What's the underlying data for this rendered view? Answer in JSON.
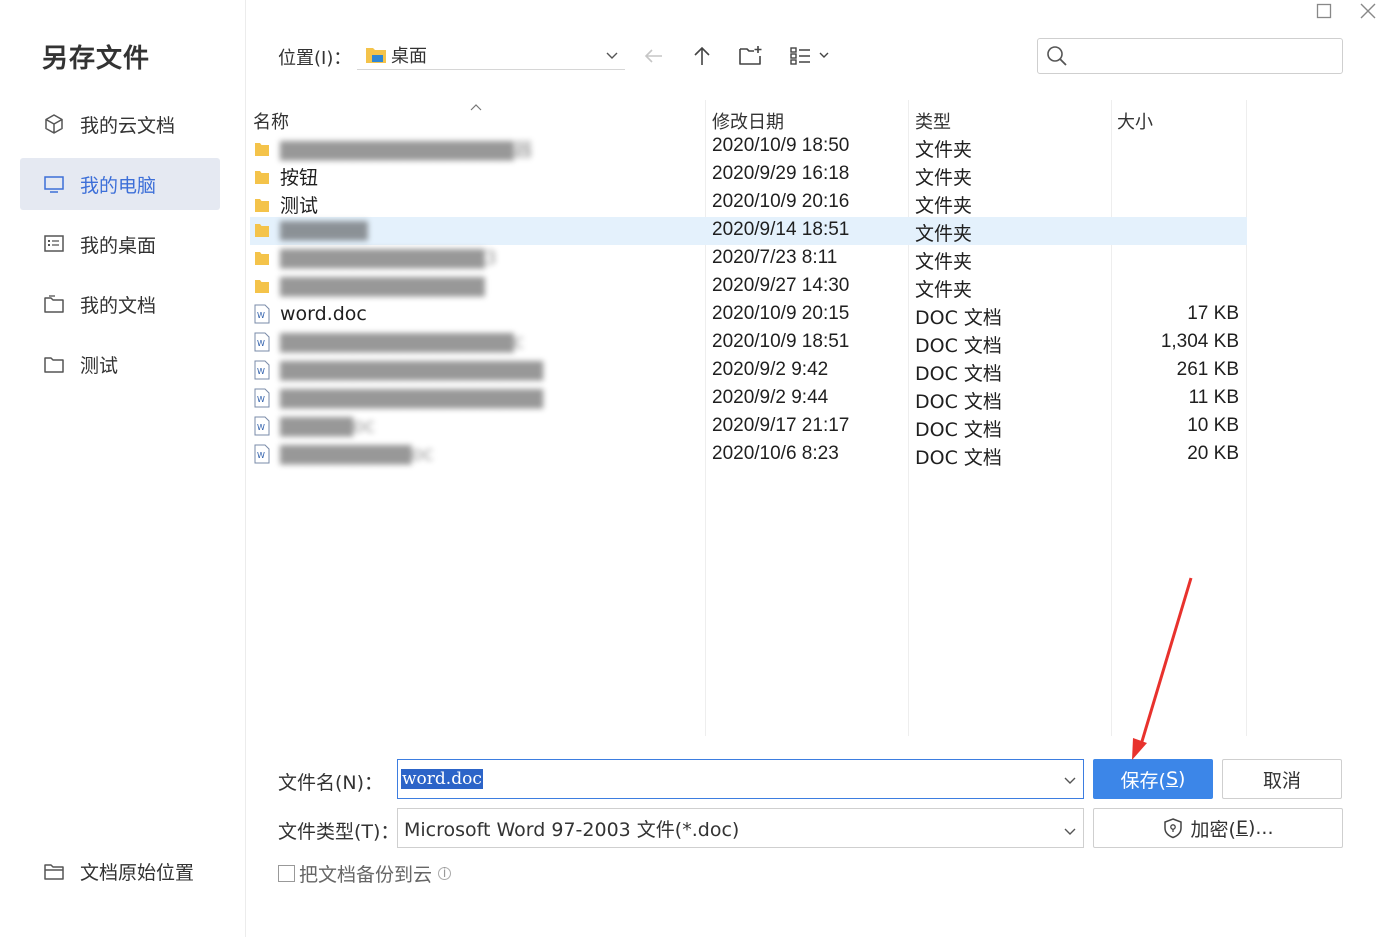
{
  "dialog": {
    "title": "另存文件"
  },
  "colors": {
    "accent": "#3c86e8",
    "selection": "#2c64c8",
    "active_nav_bg": "#e5e9f2",
    "arrow": "#e8322d"
  },
  "sidebar": {
    "items": [
      {
        "label": "我的云文档",
        "icon": "cloud-cube-icon"
      },
      {
        "label": "我的电脑",
        "icon": "monitor-icon",
        "active": true
      },
      {
        "label": "我的桌面",
        "icon": "desktop-icon"
      },
      {
        "label": "我的文档",
        "icon": "documents-icon"
      },
      {
        "label": "测试",
        "icon": "folder-icon"
      }
    ],
    "bottom": {
      "label": "文档原始位置",
      "icon": "folder-icon"
    }
  },
  "toolbar": {
    "location_label": "位置(I)：",
    "location_value": "桌面",
    "search_placeholder": ""
  },
  "file_list": {
    "columns": {
      "name": "名称",
      "date": "修改日期",
      "type": "类型",
      "size": "大小"
    },
    "rows": [
      {
        "name": "▇▇▇▇▇▇▇▇▇▇▇▇▇▇▇▇器",
        "date": "2020/10/9 18:50",
        "type": "文件夹",
        "size": "",
        "kind": "folder",
        "blur": true
      },
      {
        "name": "按钮",
        "date": "2020/9/29 16:18",
        "type": "文件夹",
        "size": "",
        "kind": "folder",
        "blur": false
      },
      {
        "name": "测试",
        "date": "2020/10/9 20:16",
        "type": "文件夹",
        "size": "",
        "kind": "folder",
        "blur": false
      },
      {
        "name": "▇▇▇▇▇▇",
        "date": "2020/9/14 18:51",
        "type": "文件夹",
        "size": "",
        "kind": "folder",
        "blur": true,
        "selected": true
      },
      {
        "name": "▇▇▇▇▇▇▇▇▇▇▇▇▇▇3",
        "date": "2020/7/23 8:11",
        "type": "文件夹",
        "size": "",
        "kind": "folder",
        "blur": true
      },
      {
        "name": "▇▇▇▇▇▇▇▇▇▇▇▇▇▇",
        "date": "2020/9/27 14:30",
        "type": "文件夹",
        "size": "",
        "kind": "folder",
        "blur": true
      },
      {
        "name": "word.doc",
        "date": "2020/10/9 20:15",
        "type": "DOC 文档",
        "size": "17 KB",
        "kind": "doc",
        "blur": false
      },
      {
        "name": "▇▇▇▇▇▇▇▇▇▇▇▇▇▇▇▇c",
        "date": "2020/10/9 18:51",
        "type": "DOC 文档",
        "size": "1,304 KB",
        "kind": "doc",
        "blur": true
      },
      {
        "name": "▇▇▇▇▇▇▇▇▇▇▇▇▇▇▇▇▇▇",
        "date": "2020/9/2 9:42",
        "type": "DOC 文档",
        "size": "261 KB",
        "kind": "doc",
        "blur": true
      },
      {
        "name": "▇▇▇▇▇▇▇▇▇▇▇▇▇▇▇▇▇▇",
        "date": "2020/9/2 9:44",
        "type": "DOC 文档",
        "size": "11 KB",
        "kind": "doc",
        "blur": true
      },
      {
        "name": "▇▇▇▇▇oc",
        "date": "2020/9/17 21:17",
        "type": "DOC 文档",
        "size": "10 KB",
        "kind": "doc",
        "blur": true
      },
      {
        "name": "▇▇▇▇▇▇▇▇▇oc",
        "date": "2020/10/6 8:23",
        "type": "DOC 文档",
        "size": "20 KB",
        "kind": "doc",
        "blur": true
      }
    ]
  },
  "form": {
    "filename_label": "文件名(N)：",
    "filename_value": "word.doc",
    "filetype_label": "文件类型(T)：",
    "filetype_value": "Microsoft Word 97-2003 文件(*.doc)",
    "save_label": "保存(",
    "save_key": "S",
    "save_close": ")",
    "cancel_label": "取消",
    "encrypt_label": "加密(",
    "encrypt_key": "E",
    "encrypt_close": ")...",
    "backup_label": "把文档备份到云"
  }
}
